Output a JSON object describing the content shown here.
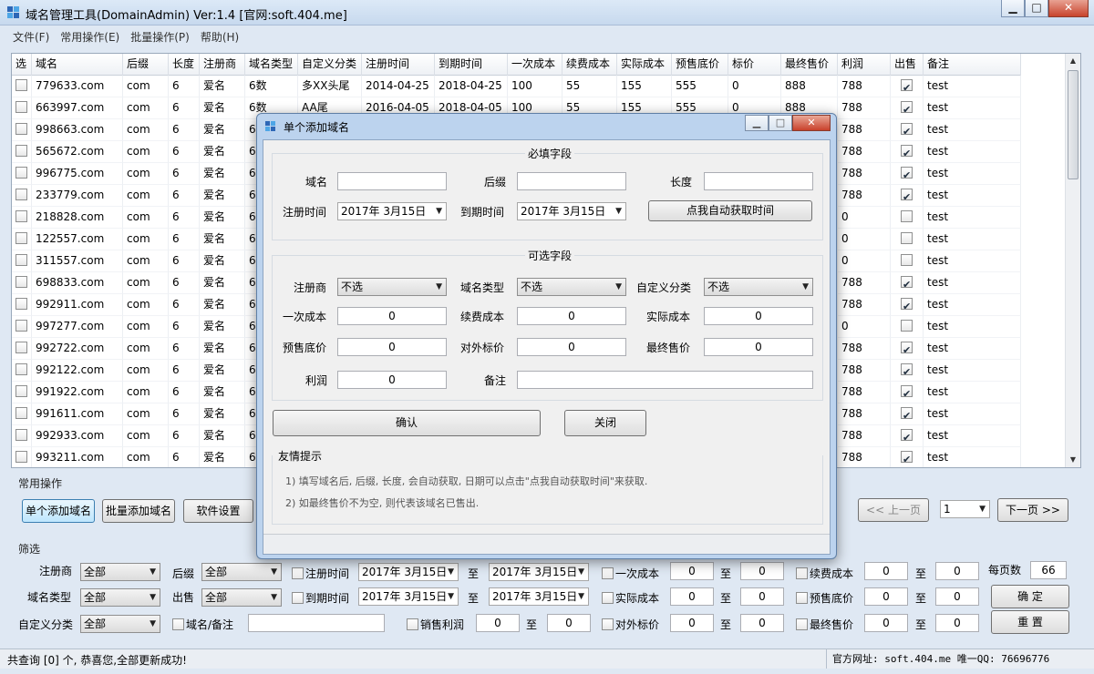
{
  "window": {
    "title": "域名管理工具(DomainAdmin) Ver:1.4   [官网:soft.404.me]",
    "minimize": "▁",
    "maximize": "□",
    "close": "✕"
  },
  "menu": [
    "文件(F)",
    "常用操作(E)",
    "批量操作(P)",
    "帮助(H)"
  ],
  "table": {
    "columns": [
      "选",
      "域名",
      "后缀",
      "长度",
      "注册商",
      "域名类型",
      "自定义分类",
      "注册时间",
      "到期时间",
      "一次成本",
      "续费成本",
      "实际成本",
      "预售底价",
      "标价",
      "最终售价",
      "利润",
      "出售",
      "备注"
    ],
    "rows": [
      {
        "domain": "779633.com",
        "suffix": "com",
        "len": "6",
        "registrar": "爱名",
        "type": "6数",
        "category": "多XX头尾",
        "reg": "2014-04-25",
        "exp": "2018-04-25",
        "cost1": "100",
        "renew": "55",
        "actual": "155",
        "presale": "555",
        "price": "0",
        "final": "888",
        "profit": "788",
        "sold": true,
        "note": "test"
      },
      {
        "domain": "663997.com",
        "suffix": "com",
        "len": "6",
        "registrar": "爱名",
        "type": "6数",
        "category": "AA尾",
        "reg": "2016-04-05",
        "exp": "2018-04-05",
        "cost1": "100",
        "renew": "55",
        "actual": "155",
        "presale": "555",
        "price": "0",
        "final": "888",
        "profit": "788",
        "sold": true,
        "note": "test"
      },
      {
        "domain": "998663.com",
        "suffix": "com",
        "len": "6",
        "registrar": "爱名",
        "type": "6",
        "category": "",
        "reg": "",
        "exp": "",
        "cost1": "",
        "renew": "",
        "actual": "",
        "presale": "",
        "price": "",
        "final": "",
        "profit": "788",
        "sold": true,
        "note": "test"
      },
      {
        "domain": "565672.com",
        "suffix": "com",
        "len": "6",
        "registrar": "爱名",
        "type": "6",
        "category": "",
        "reg": "",
        "exp": "",
        "cost1": "",
        "renew": "",
        "actual": "",
        "presale": "",
        "price": "",
        "final": "",
        "profit": "788",
        "sold": true,
        "note": "test"
      },
      {
        "domain": "996775.com",
        "suffix": "com",
        "len": "6",
        "registrar": "爱名",
        "type": "6",
        "category": "",
        "reg": "",
        "exp": "",
        "cost1": "",
        "renew": "",
        "actual": "",
        "presale": "",
        "price": "",
        "final": "",
        "profit": "788",
        "sold": true,
        "note": "test"
      },
      {
        "domain": "233779.com",
        "suffix": "com",
        "len": "6",
        "registrar": "爱名",
        "type": "6",
        "category": "",
        "reg": "",
        "exp": "",
        "cost1": "",
        "renew": "",
        "actual": "",
        "presale": "",
        "price": "",
        "final": "",
        "profit": "788",
        "sold": true,
        "note": "test"
      },
      {
        "domain": "218828.com",
        "suffix": "com",
        "len": "6",
        "registrar": "爱名",
        "type": "6",
        "category": "",
        "reg": "",
        "exp": "",
        "cost1": "",
        "renew": "",
        "actual": "",
        "presale": "",
        "price": "",
        "final": "",
        "profit": "0",
        "sold": false,
        "note": "test"
      },
      {
        "domain": "122557.com",
        "suffix": "com",
        "len": "6",
        "registrar": "爱名",
        "type": "6",
        "category": "",
        "reg": "",
        "exp": "",
        "cost1": "",
        "renew": "",
        "actual": "",
        "presale": "",
        "price": "",
        "final": "",
        "profit": "0",
        "sold": false,
        "note": "test"
      },
      {
        "domain": "311557.com",
        "suffix": "com",
        "len": "6",
        "registrar": "爱名",
        "type": "6",
        "category": "",
        "reg": "",
        "exp": "",
        "cost1": "",
        "renew": "",
        "actual": "",
        "presale": "",
        "price": "",
        "final": "",
        "profit": "0",
        "sold": false,
        "note": "test"
      },
      {
        "domain": "698833.com",
        "suffix": "com",
        "len": "6",
        "registrar": "爱名",
        "type": "6",
        "category": "",
        "reg": "",
        "exp": "",
        "cost1": "",
        "renew": "",
        "actual": "",
        "presale": "",
        "price": "",
        "final": "",
        "profit": "788",
        "sold": true,
        "note": "test"
      },
      {
        "domain": "992911.com",
        "suffix": "com",
        "len": "6",
        "registrar": "爱名",
        "type": "6",
        "category": "",
        "reg": "",
        "exp": "",
        "cost1": "",
        "renew": "",
        "actual": "",
        "presale": "",
        "price": "",
        "final": "",
        "profit": "788",
        "sold": true,
        "note": "test"
      },
      {
        "domain": "997277.com",
        "suffix": "com",
        "len": "6",
        "registrar": "爱名",
        "type": "6",
        "category": "",
        "reg": "",
        "exp": "",
        "cost1": "",
        "renew": "",
        "actual": "",
        "presale": "",
        "price": "",
        "final": "",
        "profit": "0",
        "sold": false,
        "note": "test"
      },
      {
        "domain": "992722.com",
        "suffix": "com",
        "len": "6",
        "registrar": "爱名",
        "type": "6",
        "category": "",
        "reg": "",
        "exp": "",
        "cost1": "",
        "renew": "",
        "actual": "",
        "presale": "",
        "price": "",
        "final": "",
        "profit": "788",
        "sold": true,
        "note": "test"
      },
      {
        "domain": "992122.com",
        "suffix": "com",
        "len": "6",
        "registrar": "爱名",
        "type": "6",
        "category": "",
        "reg": "",
        "exp": "",
        "cost1": "",
        "renew": "",
        "actual": "",
        "presale": "",
        "price": "",
        "final": "",
        "profit": "788",
        "sold": true,
        "note": "test"
      },
      {
        "domain": "991922.com",
        "suffix": "com",
        "len": "6",
        "registrar": "爱名",
        "type": "6",
        "category": "",
        "reg": "",
        "exp": "",
        "cost1": "",
        "renew": "",
        "actual": "",
        "presale": "",
        "price": "",
        "final": "",
        "profit": "788",
        "sold": true,
        "note": "test"
      },
      {
        "domain": "991611.com",
        "suffix": "com",
        "len": "6",
        "registrar": "爱名",
        "type": "6",
        "category": "",
        "reg": "",
        "exp": "",
        "cost1": "",
        "renew": "",
        "actual": "",
        "presale": "",
        "price": "",
        "final": "",
        "profit": "788",
        "sold": true,
        "note": "test"
      },
      {
        "domain": "992933.com",
        "suffix": "com",
        "len": "6",
        "registrar": "爱名",
        "type": "6",
        "category": "",
        "reg": "",
        "exp": "",
        "cost1": "",
        "renew": "",
        "actual": "",
        "presale": "",
        "price": "",
        "final": "",
        "profit": "788",
        "sold": true,
        "note": "test"
      },
      {
        "domain": "993211.com",
        "suffix": "com",
        "len": "6",
        "registrar": "爱名",
        "type": "6",
        "category": "",
        "reg": "",
        "exp": "",
        "cost1": "",
        "renew": "",
        "actual": "",
        "presale": "",
        "price": "",
        "final": "",
        "profit": "788",
        "sold": true,
        "note": "test"
      }
    ]
  },
  "common_ops": {
    "title": "常用操作",
    "add_single": "单个添加域名",
    "add_batch": "批量添加域名",
    "settings": "软件设置",
    "prev_page": "<< 上一页",
    "page_value": "1",
    "next_page": "下一页 >>"
  },
  "filter": {
    "title": "筛选",
    "registrar_label": "注册商",
    "registrar_value": "全部",
    "suffix_label": "后缀",
    "suffix_value": "全部",
    "type_label": "域名类型",
    "type_value": "全部",
    "sold_label": "出售",
    "sold_value": "全部",
    "category_label": "自定义分类",
    "category_value": "全部",
    "reg_time_label": "注册时间",
    "reg_from": "2017年 3月15日",
    "reg_to": "2017年 3月15日",
    "exp_time_label": "到期时间",
    "exp_from": "2017年 3月15日",
    "exp_to": "2017年 3月15日",
    "domain_note_label": "域名/备注",
    "domain_note_value": "",
    "sale_profit_label": "销售利润",
    "cost1_label": "一次成本",
    "actual_label": "实际成本",
    "list_price_label": "对外标价",
    "renew_label": "续费成本",
    "presale_label": "预售底价",
    "final_label": "最终售价",
    "to": "至",
    "zero": "0",
    "per_page_label": "每页数",
    "per_page_value": "66",
    "confirm": "确 定",
    "reset": "重 置"
  },
  "status": {
    "left": "共查询 [0] 个, 恭喜您,全部更新成功!",
    "right": "官方网址: soft.404.me 唯一QQ: 76696776"
  },
  "dialog": {
    "title": "单个添加域名",
    "required_title": "必填字段",
    "domain_label": "域名",
    "suffix_label": "后缀",
    "length_label": "长度",
    "reg_label": "注册时间",
    "reg_value": "2017年 3月15日",
    "exp_label": "到期时间",
    "exp_value": "2017年 3月15日",
    "auto_time": "点我自动获取时间",
    "optional_title": "可选字段",
    "registrar_label": "注册商",
    "registrar_value": "不选",
    "type_label": "域名类型",
    "type_value": "不选",
    "category_label": "自定义分类",
    "category_value": "不选",
    "cost1_label": "一次成本",
    "cost1_value": "0",
    "renew_label": "续费成本",
    "renew_value": "0",
    "actual_label": "实际成本",
    "actual_value": "0",
    "presale_label": "预售底价",
    "presale_value": "0",
    "list_label": "对外标价",
    "list_value": "0",
    "final_label": "最终售价",
    "final_value": "0",
    "profit_label": "利润",
    "profit_value": "0",
    "note_label": "备注",
    "ok": "确认",
    "close": "关闭",
    "tips_title": "友情提示",
    "tip1": "1) 填写域名后, 后缀, 长度, 会自动获取, 日期可以点击\"点我自动获取时间\"来获取.",
    "tip2": "2) 如最终售价不为空, 则代表该域名已售出."
  },
  "colors": {
    "title_bar": "#c7d9ee",
    "close_red": "#c8432c",
    "dialog_frame": "#bcd3ee"
  }
}
